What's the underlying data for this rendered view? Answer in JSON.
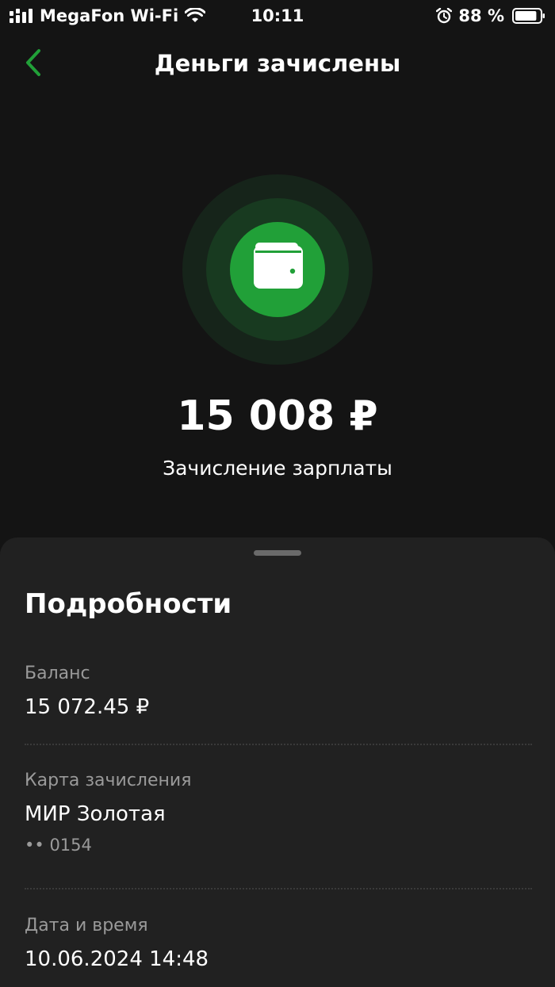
{
  "status_bar": {
    "carrier": "MegaFon Wi-Fi",
    "time": "10:11",
    "battery_percent": "88 %",
    "battery_level": 0.88,
    "icons": [
      "signal-icon",
      "wifi-icon",
      "alarm-icon",
      "battery-icon"
    ]
  },
  "header": {
    "title": "Деньги зачислены",
    "back_icon": "chevron-left-icon"
  },
  "hero": {
    "icon": "wallet-icon",
    "amount": "15 008 ₽",
    "description": "Зачисление зарплаты"
  },
  "details": {
    "title": "Подробности",
    "balance": {
      "label": "Баланс",
      "value": "15 072.45 ₽"
    },
    "card": {
      "label": "Карта зачисления",
      "value": "МИР Золотая",
      "number": "•• 0154"
    },
    "datetime": {
      "label": "Дата и время",
      "value": "10.06.2024 14:48"
    }
  },
  "colors": {
    "background": "#141414",
    "sheet": "#212121",
    "accent_green": "#21a038",
    "back_arrow": "#21a038",
    "muted_text": "#9a9a9a"
  }
}
